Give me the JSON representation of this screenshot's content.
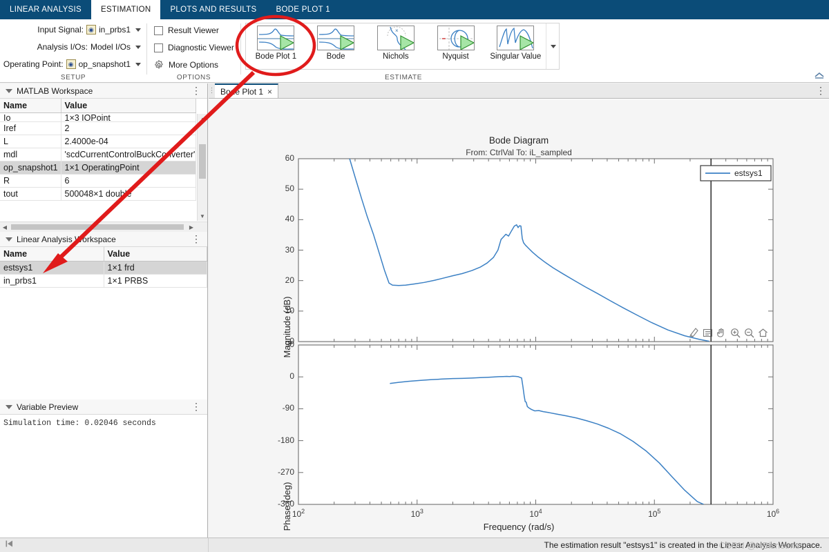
{
  "ribbon": {
    "tabs": [
      {
        "label": "LINEAR ANALYSIS",
        "active": false
      },
      {
        "label": "ESTIMATION",
        "active": true
      },
      {
        "label": "PLOTS AND RESULTS",
        "active": false
      },
      {
        "label": "BODE PLOT 1",
        "active": false
      }
    ],
    "setup": {
      "group_label": "SETUP",
      "input_signal_label": "Input Signal:",
      "input_signal_value": "in_prbs1",
      "analysis_ios_label": "Analysis I/Os:",
      "analysis_ios_value": "Model I/Os",
      "operating_point_label": "Operating Point:",
      "operating_point_value": "op_snapshot1"
    },
    "options": {
      "group_label": "OPTIONS",
      "result_viewer": "Result Viewer",
      "diagnostic_viewer": "Diagnostic Viewer",
      "more_options": "More Options",
      "result_viewer_checked": false,
      "diagnostic_viewer_checked": false
    },
    "estimate": {
      "group_label": "ESTIMATE",
      "items": [
        {
          "label": "Bode Plot 1",
          "icon": "bode-plot-icon"
        },
        {
          "label": "Bode",
          "icon": "bode-icon"
        },
        {
          "label": "Nichols",
          "icon": "nichols-icon"
        },
        {
          "label": "Nyquist",
          "icon": "nyquist-icon"
        },
        {
          "label": "Singular Value",
          "icon": "singular-value-icon"
        }
      ]
    }
  },
  "matlab_workspace": {
    "title": "MATLAB Workspace",
    "columns": [
      "Name",
      "Value"
    ],
    "rows": [
      {
        "name": "Io",
        "value": "1×3 IOPoint",
        "selected": false,
        "clipped": true
      },
      {
        "name": "Iref",
        "value": "2",
        "selected": false
      },
      {
        "name": "L",
        "value": "2.4000e-04",
        "selected": false
      },
      {
        "name": "mdl",
        "value": "'scdCurrentControlBuckConverter'",
        "selected": false
      },
      {
        "name": "op_snapshot1",
        "value": "1×1 OperatingPoint",
        "selected": true
      },
      {
        "name": "R",
        "value": "6",
        "selected": false
      },
      {
        "name": "tout",
        "value": "500048×1 double",
        "selected": false
      }
    ]
  },
  "linear_analysis_workspace": {
    "title": "Linear Analysis Workspace",
    "columns": [
      "Name",
      "Value"
    ],
    "rows": [
      {
        "name": "estsys1",
        "value": "1×1 frd",
        "selected": true
      },
      {
        "name": "in_prbs1",
        "value": "1×1 PRBS",
        "selected": false
      }
    ]
  },
  "variable_preview": {
    "title": "Variable Preview",
    "text": "Simulation time: 0.02046 seconds"
  },
  "document": {
    "tab_label": "Bode Plot 1",
    "close_glyph": "×"
  },
  "status": {
    "message": "The estimation result \"estsys1\" is created in the Linear Analysis Workspace.",
    "watermark": "CSDN @HBisnotme"
  },
  "axes_toolbar": {
    "buttons": [
      {
        "name": "brush-icon",
        "title": "Brush/Select Data"
      },
      {
        "name": "data-tips-icon",
        "title": "Data Tips"
      },
      {
        "name": "pan-icon",
        "title": "Pan"
      },
      {
        "name": "zoom-in-icon",
        "title": "Zoom In"
      },
      {
        "name": "zoom-out-icon",
        "title": "Zoom Out"
      },
      {
        "name": "restore-view-icon",
        "title": "Restore View"
      }
    ]
  },
  "chart_data": {
    "type": "line",
    "title": "Bode Diagram",
    "subtitle": "From: CtrlVal  To: iL_sampled",
    "legend": [
      "estsys1"
    ],
    "legend_position": "top-right",
    "line_color": "#3b80c4",
    "xlabel": "Frequency  (rad/s)",
    "xscale": "log",
    "xlim": [
      100,
      1000000
    ],
    "xticks": [
      100,
      1000,
      10000,
      100000,
      1000000
    ],
    "xticklabels": [
      "10²",
      "10³",
      "10⁴",
      "10⁵",
      "10⁶"
    ],
    "grid": false,
    "nyquist_marker_freq": 300000,
    "panels": [
      {
        "ylabel": "Magnitude (dB)",
        "ylim": [
          0,
          60
        ],
        "yticks": [
          0,
          10,
          20,
          30,
          40,
          50,
          60
        ],
        "series": [
          {
            "name": "estsys1",
            "points": [
              [
                270,
                60
              ],
              [
                300,
                54
              ],
              [
                340,
                47
              ],
              [
                380,
                41
              ],
              [
                430,
                35
              ],
              [
                480,
                29
              ],
              [
                530,
                23.5
              ],
              [
                580,
                19.2
              ],
              [
                620,
                18.5
              ],
              [
                700,
                18.4
              ],
              [
                800,
                18.5
              ],
              [
                950,
                18.9
              ],
              [
                1150,
                19.4
              ],
              [
                1400,
                20.1
              ],
              [
                1700,
                20.9
              ],
              [
                2000,
                21.6
              ],
              [
                2400,
                22.3
              ],
              [
                2900,
                23.3
              ],
              [
                3400,
                24.4
              ],
              [
                3900,
                25.8
              ],
              [
                4400,
                27.6
              ],
              [
                4800,
                30.0
              ],
              [
                5100,
                33.5
              ],
              [
                5300,
                34.2
              ],
              [
                5600,
                35.2
              ],
              [
                5900,
                34.6
              ],
              [
                6200,
                36.1
              ],
              [
                6600,
                37.9
              ],
              [
                6900,
                38.3
              ],
              [
                7100,
                37.4
              ],
              [
                7300,
                38.0
              ],
              [
                7500,
                37.9
              ],
              [
                7700,
                33.8
              ],
              [
                7900,
                32.4
              ],
              [
                8200,
                31.6
              ],
              [
                8700,
                30.6
              ],
              [
                9400,
                29.3
              ],
              [
                10500,
                27.7
              ],
              [
                12000,
                26.0
              ],
              [
                14000,
                24.2
              ],
              [
                17000,
                22.2
              ],
              [
                21000,
                20.1
              ],
              [
                26000,
                18.0
              ],
              [
                33000,
                15.8
              ],
              [
                42000,
                13.5
              ],
              [
                55000,
                11.0
              ],
              [
                72000,
                8.6
              ],
              [
                95000,
                6.2
              ],
              [
                130000,
                3.8
              ],
              [
                180000,
                1.9
              ],
              [
                240000,
                0.7
              ],
              [
                290000,
                0.1
              ]
            ]
          }
        ]
      },
      {
        "ylabel": "Phase (deg)",
        "ylim": [
          -360,
          90
        ],
        "yticks": [
          90,
          0,
          -90,
          -180,
          -270,
          -360
        ],
        "series": [
          {
            "name": "estsys1",
            "points": [
              [
                590,
                -18.5
              ],
              [
                700,
                -15.5
              ],
              [
                850,
                -12.5
              ],
              [
                1050,
                -10.0
              ],
              [
                1300,
                -8.0
              ],
              [
                1600,
                -6.3
              ],
              [
                2000,
                -4.8
              ],
              [
                2400,
                -4.2
              ],
              [
                2900,
                -3.2
              ],
              [
                3400,
                -2.0
              ],
              [
                3900,
                -1.2
              ],
              [
                4400,
                -0.4
              ],
              [
                4900,
                0.6
              ],
              [
                5300,
                1.0
              ],
              [
                5700,
                1.4
              ],
              [
                6000,
                0.8
              ],
              [
                6400,
                1.9
              ],
              [
                6800,
                1.3
              ],
              [
                7100,
                0.7
              ],
              [
                7400,
                -1.6
              ],
              [
                7600,
                -3.0
              ],
              [
                7800,
                -28
              ],
              [
                8000,
                -55
              ],
              [
                8150,
                -70
              ],
              [
                8300,
                -71
              ],
              [
                8500,
                -84
              ],
              [
                8800,
                -88
              ],
              [
                9200,
                -92
              ],
              [
                9800,
                -96
              ],
              [
                10600,
                -95
              ],
              [
                11500,
                -98
              ],
              [
                13000,
                -101
              ],
              [
                15000,
                -105
              ],
              [
                18000,
                -110
              ],
              [
                22000,
                -116
              ],
              [
                27000,
                -124
              ],
              [
                33000,
                -133
              ],
              [
                41000,
                -145
              ],
              [
                52000,
                -161
              ],
              [
                66000,
                -182
              ],
              [
                85000,
                -209
              ],
              [
                110000,
                -243
              ],
              [
                140000,
                -281
              ],
              [
                180000,
                -320
              ],
              [
                230000,
                -352
              ],
              [
                260000,
                -360
              ]
            ]
          }
        ]
      }
    ]
  },
  "annotation": {
    "type": "callout",
    "circle": "red-ellipse-highlight",
    "arrow": "red-arrow",
    "color": "#e01b1b"
  }
}
